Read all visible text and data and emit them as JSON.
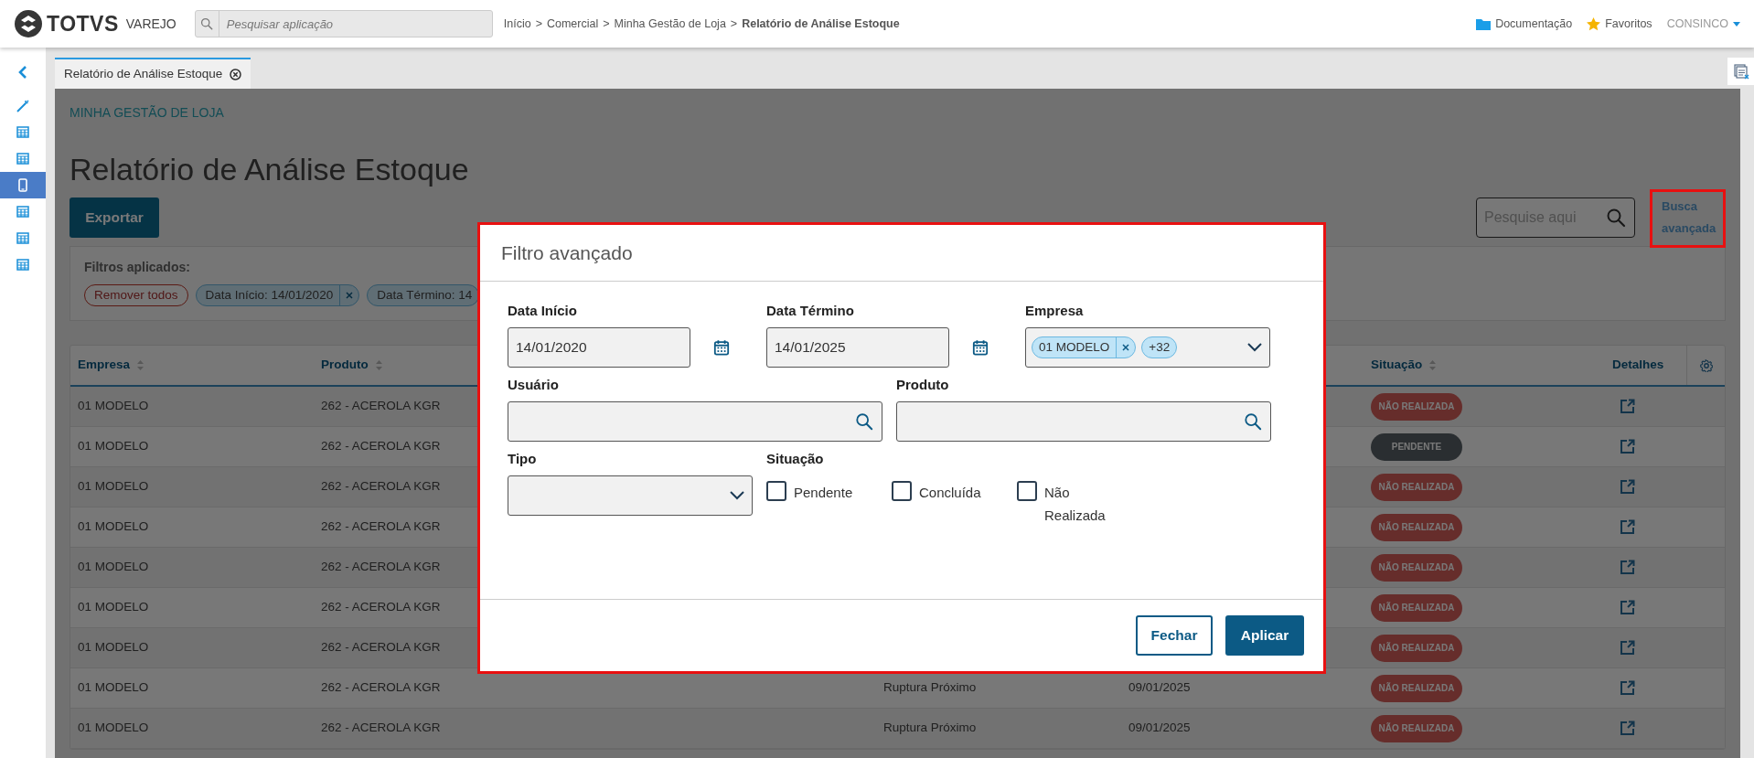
{
  "topbar": {
    "brand": "TOTVS",
    "brand_sub": "VAREJO",
    "search": {
      "placeholder": "Pesquisar aplicação"
    },
    "breadcrumb": [
      {
        "label": "Início",
        "current": false
      },
      {
        "label": "Comercial",
        "current": false
      },
      {
        "label": "Minha Gestão de Loja",
        "current": false
      },
      {
        "label": "Relatório de Análise Estoque",
        "current": true
      }
    ],
    "separator": ">",
    "links": [
      {
        "label": "Documentação",
        "kind": "docs"
      },
      {
        "label": "Favoritos",
        "kind": "favorites"
      }
    ],
    "user": "CONSINCO"
  },
  "sidebar": {
    "items": [
      {
        "kind": "back",
        "selected": false
      },
      {
        "kind": "wand",
        "selected": false
      },
      {
        "kind": "table",
        "selected": false
      },
      {
        "kind": "table",
        "selected": false
      },
      {
        "kind": "mobile",
        "selected": true
      },
      {
        "kind": "table",
        "selected": false
      },
      {
        "kind": "table",
        "selected": false
      },
      {
        "kind": "table",
        "selected": false
      }
    ]
  },
  "tabs": [
    {
      "label": "Relatório de Análise Estoque",
      "selected": true
    }
  ],
  "page": {
    "section": "MINHA GESTÃO DE LOJA",
    "title": "Relatório de Análise Estoque",
    "export_button": "Exportar",
    "search": {
      "placeholder": "Pesquise aqui"
    },
    "advanced_search": {
      "label": "Busca avançada",
      "highlighted": true
    },
    "filters": {
      "label": "Filtros aplicados:",
      "remove_all": "Remover todos",
      "chips": [
        {
          "label": "Data Início: 14/01/2020",
          "removable": true
        },
        {
          "label": "Data Término: 14",
          "removable": false
        }
      ]
    }
  },
  "table": {
    "header": {
      "empresa": "Empresa",
      "produto": "Produto",
      "situacao": "Situação",
      "detalhes": "Detalhes"
    },
    "rows": [
      {
        "empresa": "01 MODELO",
        "produto": "262 - ACEROLA KGR",
        "situacao": {
          "label": "NÃO REALIZADA",
          "kind": "nao_realizada"
        }
      },
      {
        "empresa": "01 MODELO",
        "produto": "262 - ACEROLA KGR",
        "situacao": {
          "label": "PENDENTE",
          "kind": "pendente"
        }
      },
      {
        "empresa": "01 MODELO",
        "produto": "262 - ACEROLA KGR",
        "situacao": {
          "label": "NÃO REALIZADA",
          "kind": "nao_realizada"
        }
      },
      {
        "empresa": "01 MODELO",
        "produto": "262 - ACEROLA KGR",
        "situacao": {
          "label": "NÃO REALIZADA",
          "kind": "nao_realizada"
        }
      },
      {
        "empresa": "01 MODELO",
        "produto": "262 - ACEROLA KGR",
        "situacao": {
          "label": "NÃO REALIZADA",
          "kind": "nao_realizada"
        }
      },
      {
        "empresa": "01 MODELO",
        "produto": "262 - ACEROLA KGR",
        "situacao": {
          "label": "NÃO REALIZADA",
          "kind": "nao_realizada"
        }
      },
      {
        "empresa": "01 MODELO",
        "produto": "262 - ACEROLA KGR",
        "situacao": {
          "label": "NÃO REALIZADA",
          "kind": "nao_realizada"
        }
      },
      {
        "empresa": "01 MODELO",
        "produto": "262 - ACEROLA KGR",
        "column_3": "Ruptura Próximo",
        "column_4": "09/01/2025",
        "situacao": {
          "label": "NÃO REALIZADA",
          "kind": "nao_realizada"
        }
      },
      {
        "empresa": "01 MODELO",
        "produto": "262 - ACEROLA KGR",
        "column_3": "Ruptura Próximo",
        "column_4": "09/01/2025",
        "situacao": {
          "label": "NÃO REALIZADA",
          "kind": "nao_realizada"
        }
      }
    ]
  },
  "modal": {
    "title": "Filtro avançado",
    "highlighted": true,
    "date_start": {
      "label": "Data Início",
      "value": "14/01/2020"
    },
    "date_end": {
      "label": "Data Término",
      "value": "14/01/2025"
    },
    "empresa": {
      "label": "Empresa",
      "chips": [
        {
          "label": "01 MODELO",
          "removable": true
        },
        {
          "label": "+32",
          "removable": false
        }
      ]
    },
    "usuario": {
      "label": "Usuário"
    },
    "produto": {
      "label": "Produto"
    },
    "tipo": {
      "label": "Tipo"
    },
    "situacao": {
      "label": "Situação",
      "options": [
        {
          "label": "Pendente",
          "checked": false
        },
        {
          "label": "Concluída",
          "checked": false
        },
        {
          "label": "Não Realizada",
          "checked": false
        }
      ]
    },
    "buttons": [
      {
        "label": "Fechar",
        "kind": "secondary"
      },
      {
        "label": "Aplicar",
        "kind": "primary"
      }
    ]
  }
}
